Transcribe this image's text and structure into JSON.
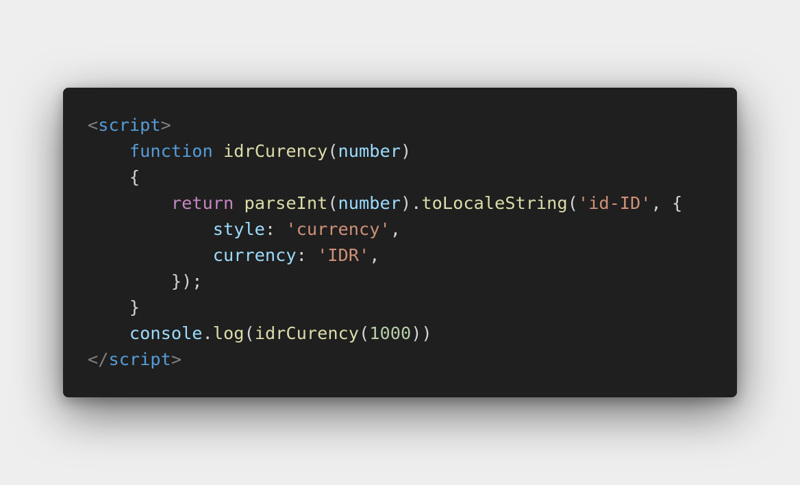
{
  "colors": {
    "page_background": "#eeeeee",
    "editor_background": "#1f1f1f",
    "tag_bracket": "#808080",
    "tag_name": "#569cd6",
    "keyword": "#569cd6",
    "control_keyword": "#c586c0",
    "function_name": "#dcdcaa",
    "variable": "#9cdcfe",
    "string": "#ce9178",
    "number": "#b5cea8",
    "punctuation": "#d4d4d4"
  },
  "code": {
    "open_tag": {
      "lt": "<",
      "name": "script",
      "gt": ">"
    },
    "fn_keyword": "function",
    "fn_name": "idrCurency",
    "param": "number",
    "open_brace": "{",
    "return_keyword": "return",
    "parse_fn": "parseInt",
    "locale_method": "toLocaleString",
    "locale_string": "'id-ID'",
    "style_key": "style",
    "style_value": "'currency'",
    "currency_key": "currency",
    "currency_value": "'IDR'",
    "close_options": "});",
    "close_brace": "}",
    "console_obj": "console",
    "log_fn": "log",
    "call_fn": "idrCurency",
    "call_arg": "1000",
    "close_tag": {
      "lt": "</",
      "name": "script",
      "gt": ">"
    }
  }
}
